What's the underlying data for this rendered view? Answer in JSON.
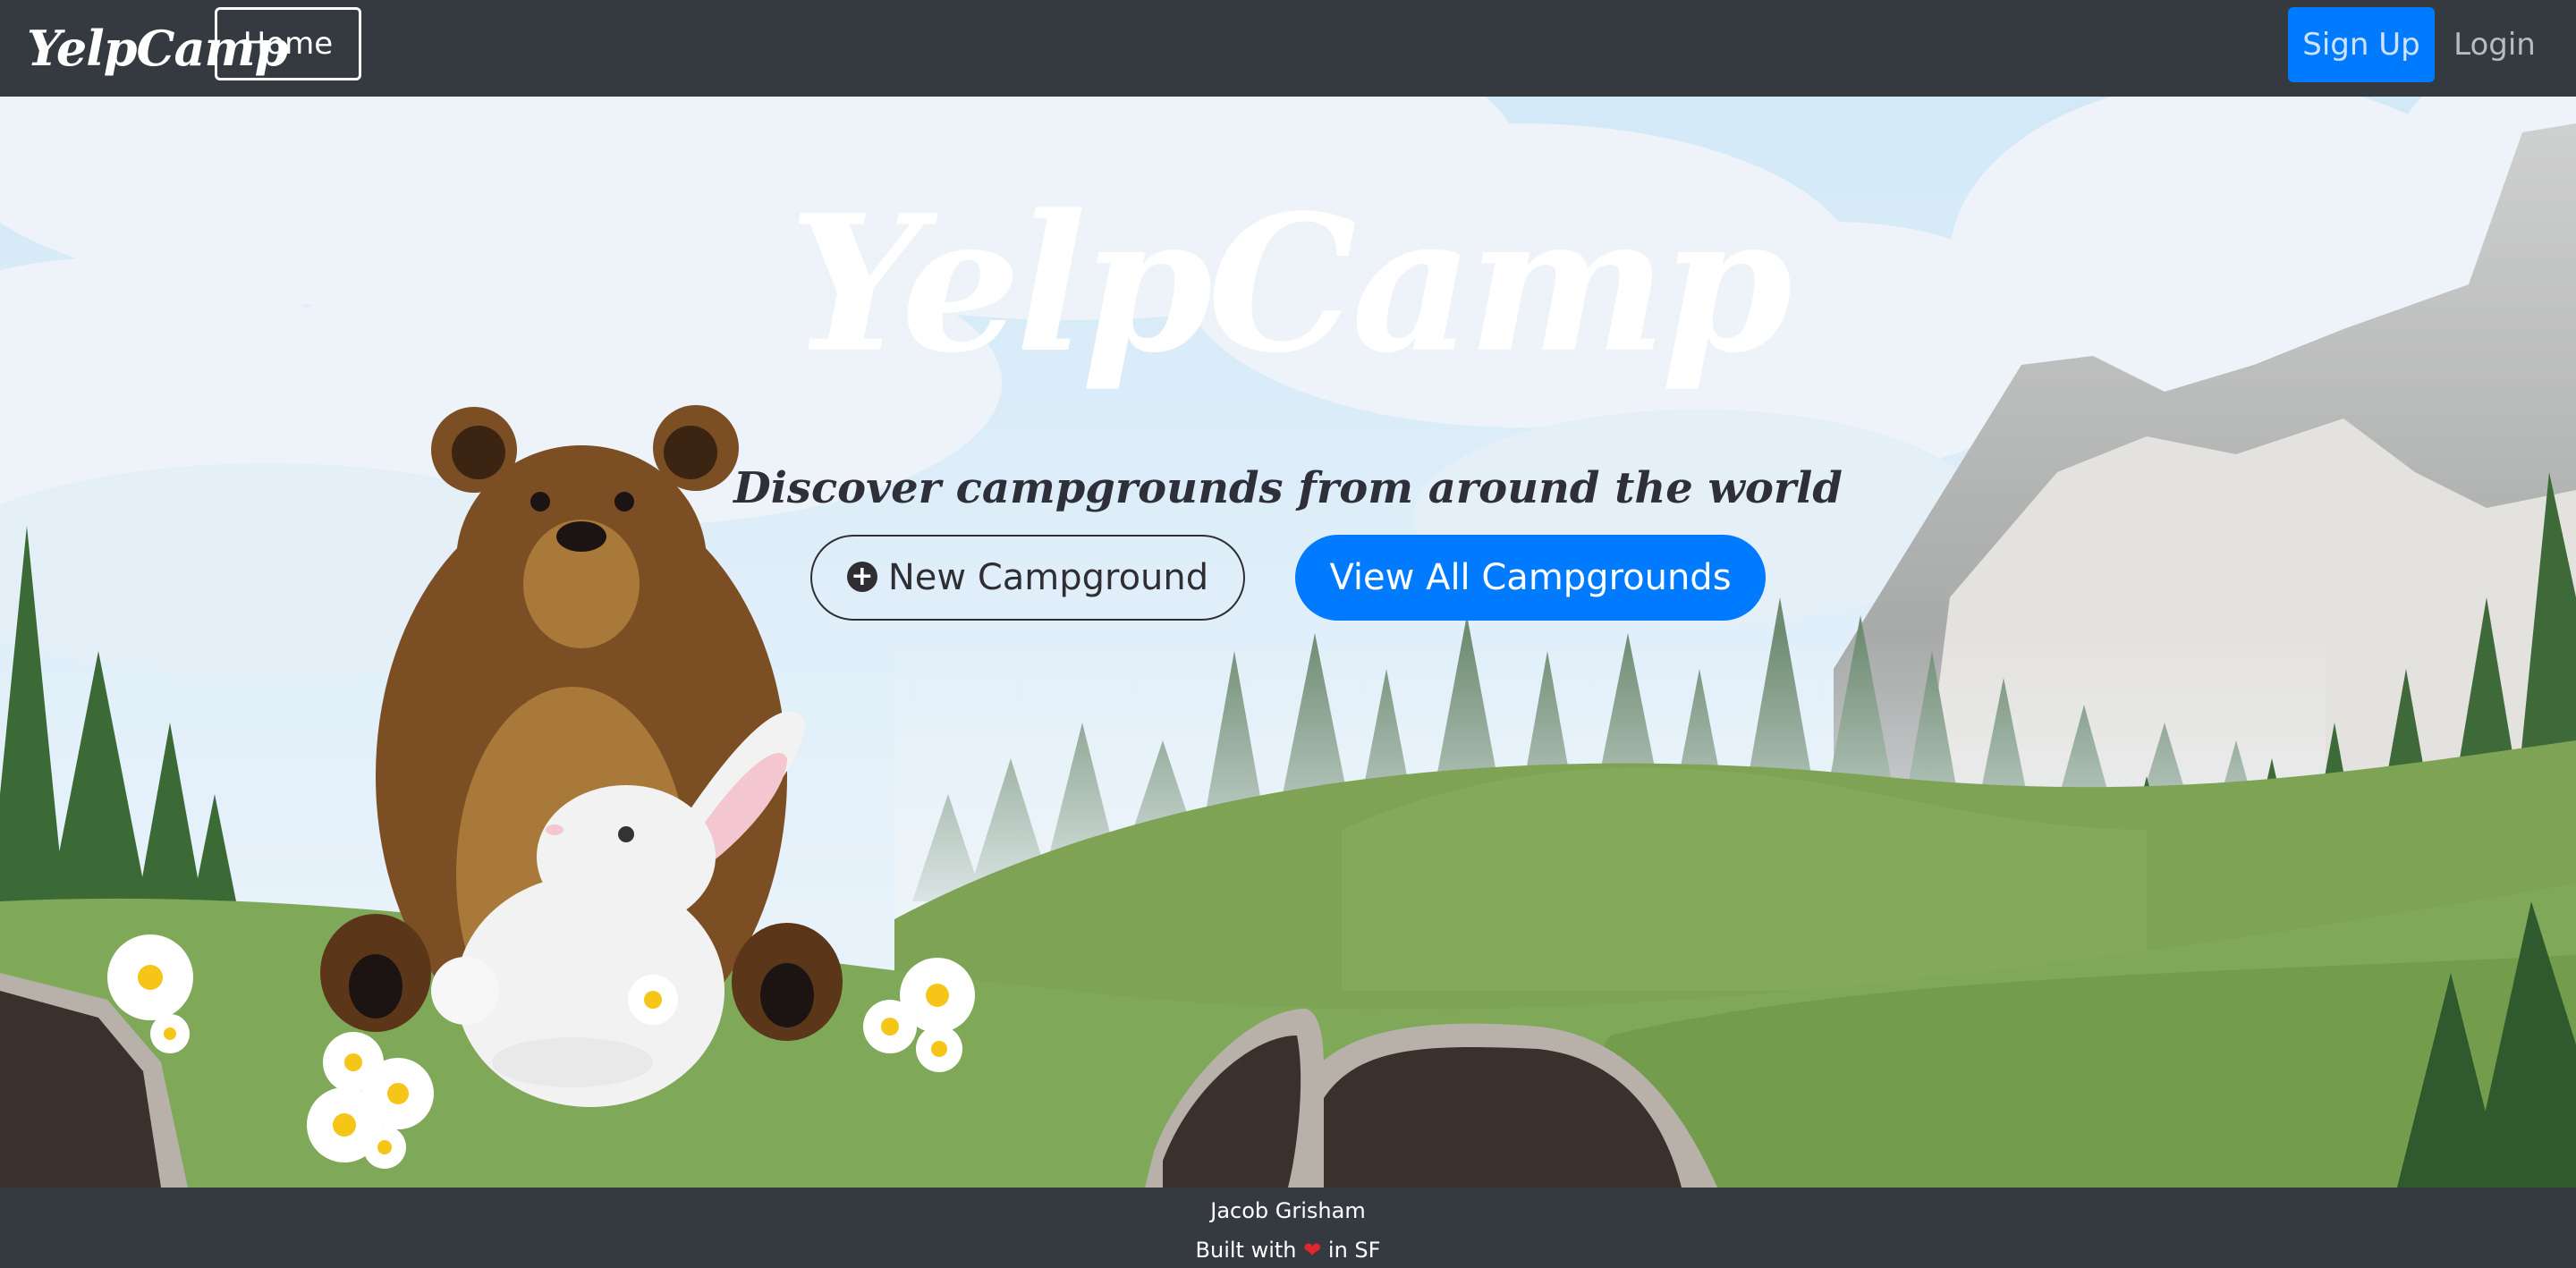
{
  "navbar": {
    "brand": "YelpCamp",
    "home_label": "Home",
    "signup_label": "Sign Up",
    "login_label": "Login"
  },
  "hero": {
    "title": "YelpCamp",
    "tagline": "Discover campgrounds from around the world",
    "new_campground_label": "New Campground",
    "new_campground_icon": "plus-circle-icon",
    "view_all_label": "View All Campgrounds"
  },
  "footer": {
    "author": "Jacob Grisham",
    "built_prefix": "Built with",
    "heart_icon": "heart-icon",
    "built_suffix": "in SF"
  },
  "colors": {
    "navbar_bg": "#343a40",
    "primary": "#007bff",
    "sky": "#d7ebf8",
    "grass": "#7fa858",
    "bear": "#7b4e24"
  }
}
